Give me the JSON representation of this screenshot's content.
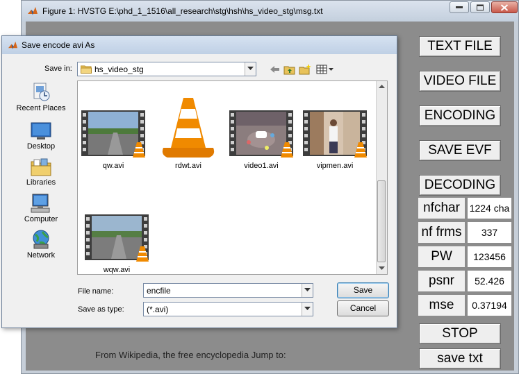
{
  "figure": {
    "title": "Figure 1:  HVSTG E:\\phd_1_1516\\all_research\\stg\\hsh\\hs_video_stg\\msg.txt",
    "background_text": "From Wikipedia, the free encyclopedia   Jump to:",
    "buttons": {
      "text_file": "TEXT FILE",
      "video_file": "VIDEO FILE",
      "encoding": "ENCODING",
      "save_evf": "SAVE EVF",
      "decoding": "DECODING",
      "stop": "STOP",
      "save_txt": "save txt"
    },
    "fields": [
      {
        "label": "nfchar",
        "value": "1224 cha"
      },
      {
        "label": "nf frms",
        "value": "337"
      },
      {
        "label": "PW",
        "value": "123456"
      },
      {
        "label": "psnr",
        "value": "52.426"
      },
      {
        "label": "mse",
        "value": "0.37194"
      }
    ]
  },
  "dialog": {
    "title": "Save encode avi As",
    "save_in_label": "Save in:",
    "save_in_value": "hs_video_stg",
    "places": [
      "Recent Places",
      "Desktop",
      "Libraries",
      "Computer",
      "Network"
    ],
    "files": [
      "qw.avi",
      "rdwt.avi",
      "video1.avi",
      "vipmen.avi",
      "wqw.avi"
    ],
    "file_name_label": "File name:",
    "file_name_value": "encfile",
    "save_as_type_label": "Save as type:",
    "save_as_type_value": "(*.avi)",
    "save_label": "Save",
    "cancel_label": "Cancel"
  },
  "colors": {
    "figure_client": "#8c8c8c",
    "dialog_face": "#f0f0f0",
    "vlc_orange": "#f08a00"
  }
}
